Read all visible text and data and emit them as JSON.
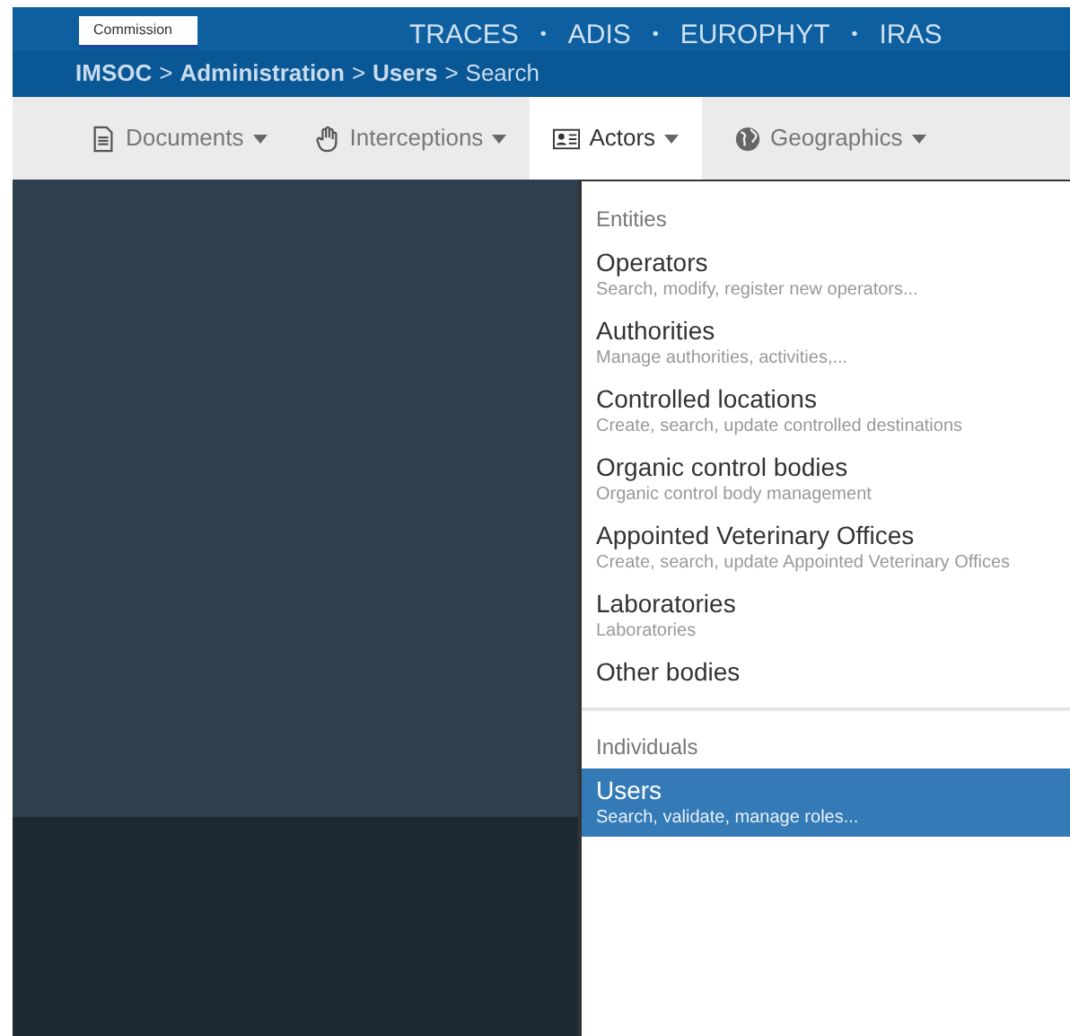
{
  "header": {
    "logo_text": "Commission",
    "apps": [
      {
        "label": "TRACES"
      },
      {
        "separator": "•",
        "label": "ADIS"
      },
      {
        "separator": "•",
        "label": "EUROPHYT"
      },
      {
        "separator": "•",
        "label": "IRAS"
      }
    ]
  },
  "breadcrumb": [
    {
      "label": "IMSOC",
      "bold": true
    },
    {
      "separator": ">",
      "label": "Administration",
      "bold": true
    },
    {
      "separator": ">",
      "label": "Users",
      "bold": true
    },
    {
      "separator": ">",
      "label": "Search",
      "bold": false
    }
  ],
  "nav": [
    {
      "label": "Documents",
      "selected": false
    },
    {
      "label": "Interceptions",
      "selected": false
    },
    {
      "label": "Actors",
      "selected": true
    },
    {
      "label": "Geographics",
      "selected": false
    }
  ],
  "menu": [
    {
      "kind": "header",
      "label": "Entities"
    },
    {
      "kind": "item",
      "label": "Operators",
      "description": "Search, modify, register new operators...",
      "selected": false
    },
    {
      "kind": "item",
      "label": "Authorities",
      "description": "Manage authorities, activities,...",
      "selected": false
    },
    {
      "kind": "item",
      "label": "Controlled locations",
      "description": "Create, search, update controlled destinations",
      "selected": false
    },
    {
      "kind": "item",
      "label": "Organic control bodies",
      "description": "Organic control body management",
      "selected": false
    },
    {
      "kind": "item",
      "label": "Appointed Veterinary Offices",
      "description": "Create, search, update Appointed Veterinary Offices",
      "selected": false
    },
    {
      "kind": "item",
      "label": "Laboratories",
      "description": "Laboratories",
      "selected": false
    },
    {
      "kind": "item",
      "label": "Other bodies",
      "selected": false
    },
    {
      "kind": "divider"
    },
    {
      "kind": "header",
      "label": "Individuals"
    },
    {
      "kind": "item",
      "label": "Users",
      "description": "Search, validate, manage roles...",
      "selected": true
    }
  ]
}
